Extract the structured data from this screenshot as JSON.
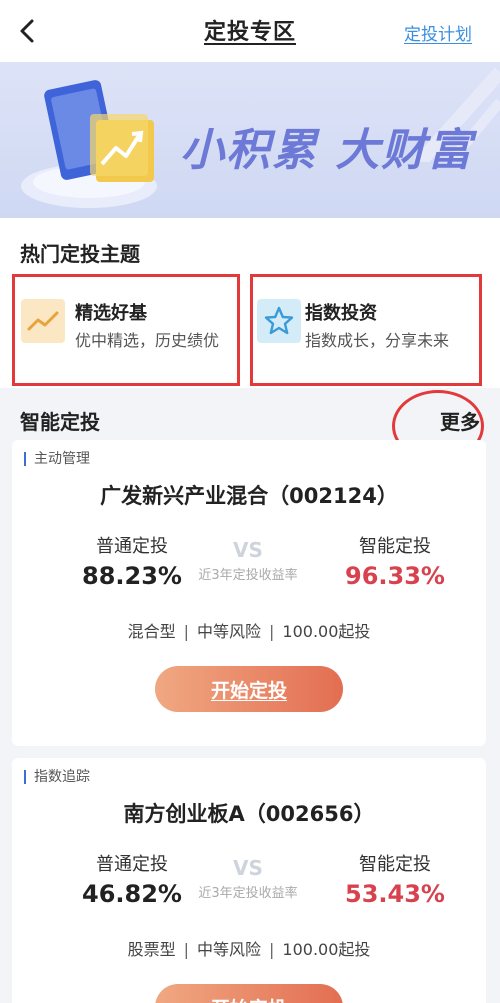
{
  "header": {
    "title": "定投专区",
    "plan_link": "定投计划"
  },
  "banner": {
    "slogan": "小积累 大财富"
  },
  "hot": {
    "title": "热门定投主题",
    "themes": [
      {
        "name": "精选好基",
        "desc": "优中精选，历史绩优",
        "icon": "trend-line-icon"
      },
      {
        "name": "指数投资",
        "desc": "指数成长，分享未来",
        "icon": "star-icon"
      }
    ]
  },
  "smart": {
    "title": "智能定投",
    "more": "更多"
  },
  "funds": [
    {
      "tag": "主动管理",
      "name": "广发新兴产业混合（002124）",
      "normal_label": "普通定投",
      "normal_value": "88.23%",
      "vs": "VS",
      "vs_caption": "近3年定投收益率",
      "smart_label": "智能定投",
      "smart_value": "96.33%",
      "type": "混合型",
      "risk": "中等风险",
      "min_invest": "100.00起投",
      "button": "开始定投"
    },
    {
      "tag": "指数追踪",
      "name": "南方创业板A（002656）",
      "normal_label": "普通定投",
      "normal_value": "46.82%",
      "vs": "VS",
      "vs_caption": "近3年定投收益率",
      "smart_label": "智能定投",
      "smart_value": "53.43%",
      "type": "股票型",
      "risk": "中等风险",
      "min_invest": "100.00起投",
      "button": "开始定投"
    }
  ],
  "colors": {
    "accent_blue": "#3b8fe0",
    "smart_red": "#d8424f",
    "annotation_red": "#e23a3a",
    "button_start": "#f0a882",
    "button_end": "#e36e52"
  }
}
